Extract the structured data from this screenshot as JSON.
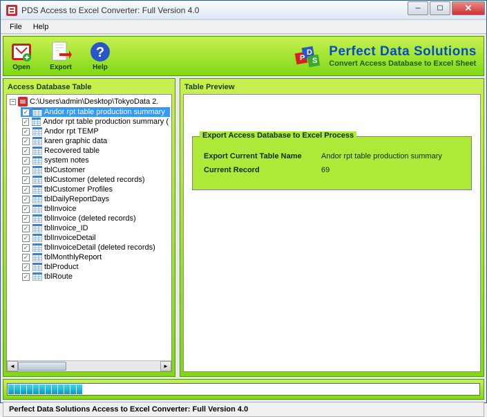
{
  "window": {
    "title": "PDS Access to Excel Converter: Full Version 4.0"
  },
  "menu": {
    "file": "File",
    "help": "Help"
  },
  "toolbar": {
    "open": "Open",
    "export": "Export",
    "help": "Help"
  },
  "brand": {
    "name": "Perfect Data Solutions",
    "sub": "Convert Access Database to Excel Sheet"
  },
  "panels": {
    "left_title": "Access Database Table",
    "right_title": "Table Preview"
  },
  "tree": {
    "root": "C:\\Users\\admin\\Desktop\\TokyoData 2.",
    "items": [
      "Andor rpt table production summary",
      "Andor rpt table production summary (",
      "Andor rpt TEMP",
      "karen graphic data",
      "Recovered table",
      "system notes",
      "tblCustomer",
      "tblCustomer (deleted records)",
      "tblCustomer Profiles",
      "tblDailyReportDays",
      "tblInvoice",
      "tblInvoice (deleted records)",
      "tblInvoice_ID",
      "tblInvoiceDetail",
      "tblInvoiceDetail (deleted records)",
      "tblMonthlyReport",
      "tblProduct",
      "tblRoute"
    ],
    "selected_index": 0
  },
  "export": {
    "legend": "Export Access Database to Excel Process",
    "label_table": "Export Current Table Name",
    "value_table": "Andor rpt table production summary",
    "label_record": "Current Record",
    "value_record": "69"
  },
  "progress": {
    "segments": 12
  },
  "status": {
    "text": "Perfect Data Solutions Access to Excel Converter: Full Version 4.0"
  }
}
